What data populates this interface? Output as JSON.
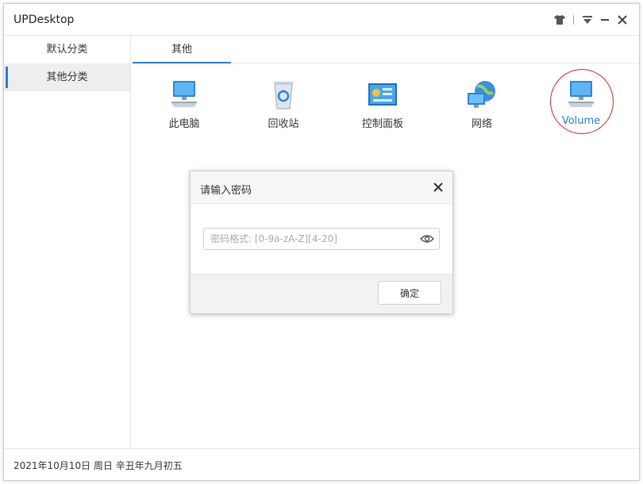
{
  "app": {
    "title": "UPDesktop"
  },
  "titlebar": {
    "icons": [
      "shirt-icon",
      "separator",
      "dropdown-icon",
      "minimize-icon",
      "close-icon"
    ]
  },
  "sidebar": {
    "items": [
      {
        "label": "默认分类",
        "active": false
      },
      {
        "label": "其他分类",
        "active": true
      }
    ]
  },
  "tabs": [
    {
      "label": "其他",
      "active": true
    }
  ],
  "grid": {
    "items": [
      {
        "label": "此电脑",
        "icon": "computer-icon"
      },
      {
        "label": "回收站",
        "icon": "recycle-bin-icon"
      },
      {
        "label": "控制面板",
        "icon": "control-panel-icon"
      },
      {
        "label": "网络",
        "icon": "network-icon"
      },
      {
        "label": "Volume",
        "icon": "volume-computer-icon",
        "highlighted": true
      }
    ]
  },
  "dialog": {
    "title": "请输入密码",
    "password_placeholder": "密码格式: [0-9a-zA-Z][4-20]",
    "password_value": "",
    "ok_label": "确定"
  },
  "footer": {
    "date_text": "2021年10月10日  周日  辛丑年九月初五"
  },
  "colors": {
    "accent": "#2a7ad6",
    "highlight_circle": "#c72b2b"
  }
}
